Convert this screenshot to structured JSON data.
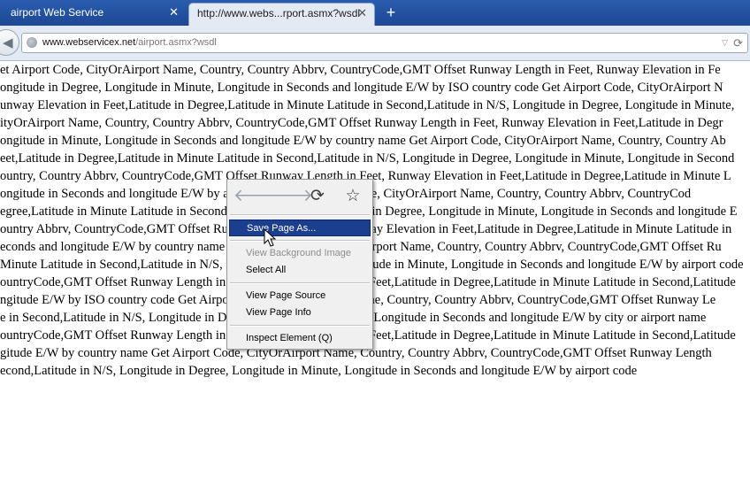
{
  "tabs": [
    {
      "label": "airport Web Service",
      "close": "✕"
    },
    {
      "label": "http://www.webs...rport.asmx?wsdl",
      "close": "✕"
    }
  ],
  "new_tab": "+",
  "url": {
    "host": "www.webservicex.net",
    "path": "/airport.asmx?wsdl"
  },
  "content_lines": [
    "et Airport Code, CityOrAirport Name, Country, Country Abbrv, CountryCode,GMT Offset Runway Length in Feet, Runway Elevation in Fe",
    "ongitude in Degree, Longitude in Minute, Longitude in Seconds and longitude E/W by ISO country code Get Airport Code, CityOrAirport N",
    "unway Elevation in Feet,Latitude in Degree,Latitude in Minute Latitude in Second,Latitude in N/S, Longitude in Degree, Longitude in Minute, ",
    "ityOrAirport Name, Country, Country Abbrv, CountryCode,GMT Offset Runway Length in Feet, Runway Elevation in Feet,Latitude in Degr",
    "ongitude in Minute, Longitude in Seconds and longitude E/W by country name Get Airport Code, CityOrAirport Name, Country, Country Ab",
    "eet,Latitude in Degree,Latitude in Minute Latitude in Second,Latitude in N/S, Longitude in Degree, Longitude in Minute, Longitude in Second",
    "ountry, Country Abbrv, CountryCode,GMT Offset Runway Length in Feet, Runway Elevation in Feet,Latitude in Degree,Latitude in Minute L",
    "ongitude in Seconds and longitude E/W by airport code Get Airport Code, CityOrAirport Name, Country, Country Abbrv, CountryCod",
    "egree,Latitude in Minute Latitude in Second,Latitude in N/S, Longitude in Degree, Longitude in Minute, Longitude in Seconds and longitude E",
    "ountry Abbrv, CountryCode,GMT Offset Runway Length in Feet, Runway Elevation in Feet,Latitude in Degree,Latitude in Minute Latitude in",
    "econds and longitude E/W by country name Get Airport Code, CityOrAirport Name, Country, Country Abbrv, CountryCode,GMT Offset Ru",
    "Minute Latitude in Second,Latitude in N/S, Longitude in Degree, Longitude in Minute, Longitude in Seconds and longitude E/W by airport code",
    "ountryCode,GMT Offset Runway Length in Feet, Runway Elevation in Feet,Latitude in Degree,Latitude in Minute Latitude in Second,Latitude",
    "ngitude E/W by ISO country code Get Airport Code, CityOrAirport Name, Country, Country Abbrv, CountryCode,GMT Offset Runway Le",
    "e in Second,Latitude in N/S, Longitude in Degree, Longitude in Minute, Longitude in Seconds and longitude E/W by city or airport name",
    "ountryCode,GMT Offset Runway Length in Feet, Runway Elevation in Feet,Latitude in Degree,Latitude in Minute Latitude in Second,Latitude",
    "gitude E/W by country name Get Airport Code, CityOrAirport Name, Country, Country Abbrv, CountryCode,GMT Offset Runway Length",
    "econd,Latitude in N/S, Longitude in Degree, Longitude in Minute, Longitude in Seconds and longitude E/W by airport code"
  ],
  "context_menu": {
    "nav_icons": [
      {
        "icon": "back-arrow-icon",
        "glyph": "🡐",
        "enabled": false
      },
      {
        "icon": "forward-arrow-icon",
        "glyph": "🡒",
        "enabled": false
      },
      {
        "icon": "reload-icon",
        "glyph": "⟳",
        "enabled": true
      },
      {
        "icon": "bookmark-star-icon",
        "glyph": "☆",
        "enabled": true
      }
    ],
    "items": {
      "save_page_as": "Save Page As...",
      "view_background_image": "View Background Image",
      "select_all": "Select All",
      "view_page_source": "View Page Source",
      "view_page_info": "View Page Info",
      "inspect_element": "Inspect Element (Q)"
    },
    "highlight_color": "#1b3e8f"
  }
}
